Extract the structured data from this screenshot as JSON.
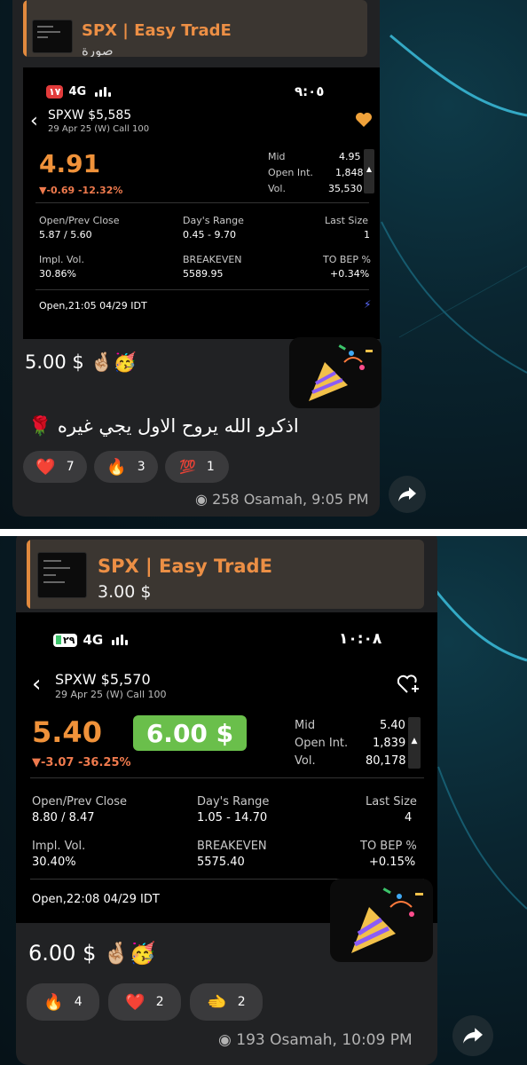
{
  "post1": {
    "reply": {
      "title": "SPX | Easy TradE",
      "subtitle": "صورة"
    },
    "shot": {
      "status": {
        "battery": "١٧",
        "network": "4G",
        "time": "٩:٠٥"
      },
      "header": {
        "back_icon": "chevron-left-icon",
        "symbol": "SPXW $5,585",
        "contract": "29 Apr 25 (W) Call 100",
        "fav_icon": "heart-filled-icon"
      },
      "price": "4.91",
      "change": "▼-0.69 -12.32%",
      "quote": [
        {
          "label": "Mid",
          "value": "4.95"
        },
        {
          "label": "Open Int.",
          "value": "1,848"
        },
        {
          "label": "Vol.",
          "value": "35,530"
        }
      ],
      "stats": [
        {
          "label": "Open/Prev Close",
          "value": "5.87 / 5.60"
        },
        {
          "label": "Day's Range",
          "value": "0.45 - 9.70"
        },
        {
          "label": "Last Size",
          "value": "1"
        },
        {
          "label": "Impl. Vol.",
          "value": "30.86%"
        },
        {
          "label": "BREAKEVEN",
          "value": "5589.95"
        },
        {
          "label": "TO BEP %",
          "value": "+0.34%"
        }
      ],
      "open_info": "Open,21:05 04/29 IDT"
    },
    "message": "5.00 $ 🤞🏼🥳",
    "arabic": "اذكرو الله يروح الاول يجي غيره 🌹",
    "reactions": [
      {
        "icon": "heart-icon",
        "glyph": "❤️",
        "count": "7"
      },
      {
        "icon": "fire-icon",
        "glyph": "🔥",
        "count": "3"
      },
      {
        "icon": "hundred-icon",
        "glyph": "💯",
        "count": "1"
      }
    ],
    "meta": "258 Osamah, 9:05 PM"
  },
  "post2": {
    "reply": {
      "title": "SPX | Easy TradE",
      "subtitle": "3.00 $"
    },
    "shot": {
      "status": {
        "battery": "٢٩",
        "network": "4G",
        "time": "١٠:٠٨"
      },
      "header": {
        "back_icon": "chevron-left-icon",
        "symbol": "SPXW $5,570",
        "contract": "29 Apr 25 (W) Call 100",
        "fav_icon": "heart-plus-icon"
      },
      "price": "5.40",
      "target_badge": "6.00 $",
      "change": "▼-3.07 -36.25%",
      "quote": [
        {
          "label": "Mid",
          "value": "5.40"
        },
        {
          "label": "Open Int.",
          "value": "1,839"
        },
        {
          "label": "Vol.",
          "value": "80,178"
        }
      ],
      "stats": [
        {
          "label": "Open/Prev Close",
          "value": "8.80 / 8.47"
        },
        {
          "label": "Day's Range",
          "value": "1.05 - 14.70"
        },
        {
          "label": "Last Size",
          "value": "4"
        },
        {
          "label": "Impl. Vol.",
          "value": "30.40%"
        },
        {
          "label": "BREAKEVEN",
          "value": "5575.40"
        },
        {
          "label": "TO BEP %",
          "value": "+0.15%"
        }
      ],
      "open_info": "Open,22:08 04/29 IDT"
    },
    "message": "6.00 $ 🤞🏼🥳",
    "reactions": [
      {
        "icon": "fire-icon",
        "glyph": "🔥",
        "count": "4"
      },
      {
        "icon": "heart-icon",
        "glyph": "❤️",
        "count": "2"
      },
      {
        "icon": "pointing-hand-icon",
        "glyph": "🫲",
        "count": "2"
      }
    ],
    "meta": "193 Osamah, 10:09 PM"
  },
  "colors": {
    "accent_orange": "#f0923a",
    "bubble": "#212224",
    "badge_green": "#6abf4b"
  }
}
